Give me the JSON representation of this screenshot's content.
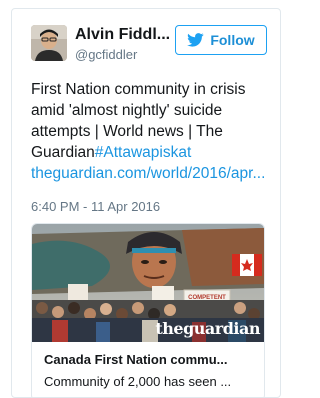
{
  "user": {
    "name": "Alvin Fiddl...",
    "handle": "@gcfiddler"
  },
  "follow_button": {
    "label": "Follow",
    "icon": "twitter-bird-icon"
  },
  "tweet": {
    "text": "First Nation community in crisis amid 'almost nightly' suicide attempts | World news | The Guardian",
    "hashtag": "#Attawapiskat",
    "link": "theguardian.com/world/2016/apr...",
    "timestamp": "6:40 PM - 11 Apr 2016"
  },
  "link_card": {
    "image_logo": "theguardian",
    "sign_text": "COMPETENT FUNDING COUNT",
    "title": "Canada First Nation commu...",
    "description": "Community of 2,000 has seen ..."
  },
  "colors": {
    "accent": "#1da1f2",
    "link": "#1b95e0",
    "muted": "#657786",
    "border": "#e1e8ed"
  }
}
